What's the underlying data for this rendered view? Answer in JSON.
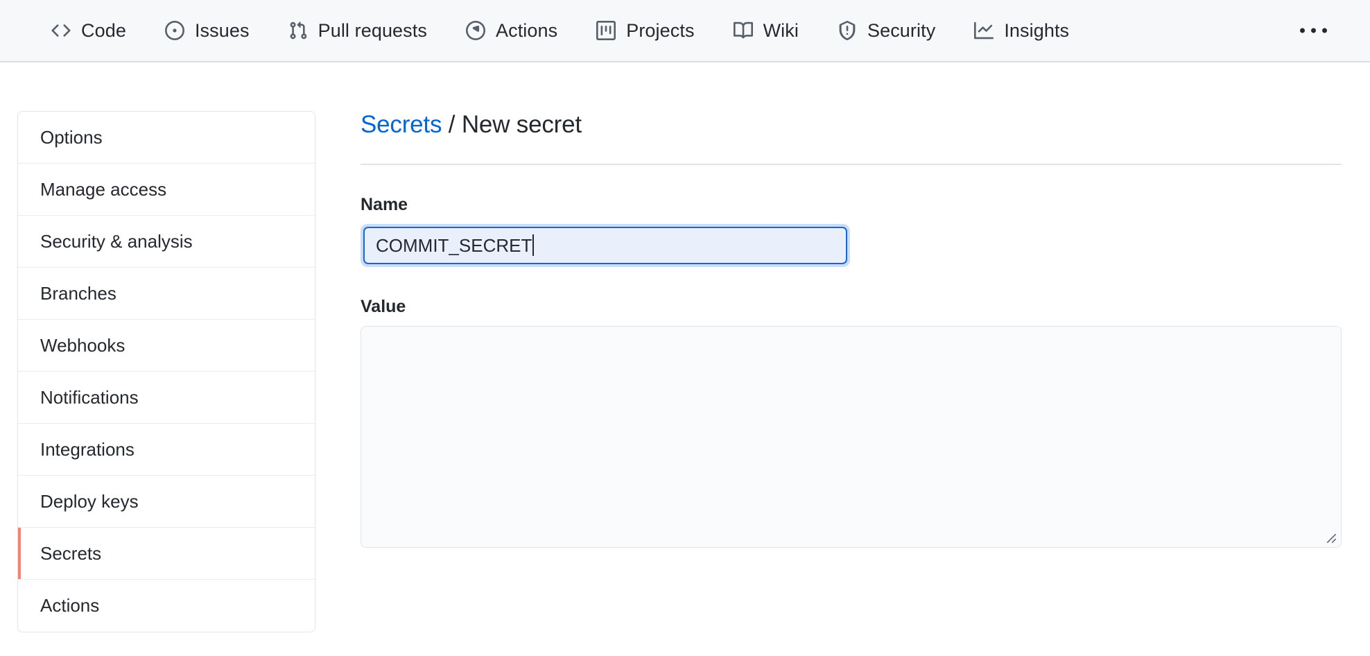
{
  "repo_nav": {
    "items": [
      {
        "label": "Code",
        "icon": "code-icon"
      },
      {
        "label": "Issues",
        "icon": "issue-opened-icon"
      },
      {
        "label": "Pull requests",
        "icon": "git-pull-request-icon"
      },
      {
        "label": "Actions",
        "icon": "play-circle-icon"
      },
      {
        "label": "Projects",
        "icon": "project-board-icon"
      },
      {
        "label": "Wiki",
        "icon": "book-icon"
      },
      {
        "label": "Security",
        "icon": "shield-alert-icon"
      },
      {
        "label": "Insights",
        "icon": "graph-line-icon"
      }
    ],
    "overflow_menu": "kebab-horizontal-icon"
  },
  "sidebar": {
    "items": [
      {
        "label": "Options",
        "active": false
      },
      {
        "label": "Manage access",
        "active": false
      },
      {
        "label": "Security & analysis",
        "active": false
      },
      {
        "label": "Branches",
        "active": false
      },
      {
        "label": "Webhooks",
        "active": false
      },
      {
        "label": "Notifications",
        "active": false
      },
      {
        "label": "Integrations",
        "active": false
      },
      {
        "label": "Deploy keys",
        "active": false
      },
      {
        "label": "Secrets",
        "active": true
      },
      {
        "label": "Actions",
        "active": false
      }
    ],
    "active_indicator_color": "#f9826c"
  },
  "main": {
    "breadcrumb_link": "Secrets",
    "breadcrumb_separator": "/",
    "breadcrumb_current": "New secret",
    "link_color": "#0366d6",
    "name_field": {
      "label": "Name",
      "value": "COMMIT_SECRET",
      "placeholder": "",
      "focused": true,
      "focus_border_color": "#1568d4",
      "focus_ring_color": "#c8ddf7",
      "focus_fill_color": "#e9f0fb"
    },
    "value_field": {
      "label": "Value",
      "value": "",
      "placeholder": "",
      "resize_handle": "resize-grip-icon"
    }
  }
}
